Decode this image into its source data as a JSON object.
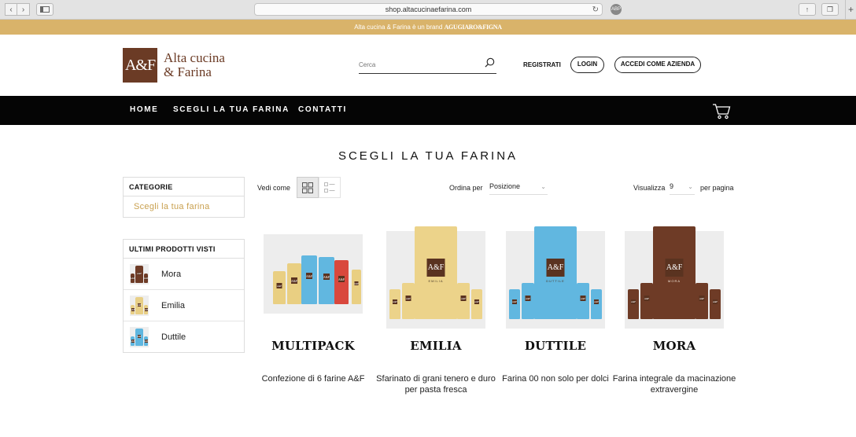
{
  "browser": {
    "url": "shop.altacucinaefarina.com",
    "ext_label": "ABP"
  },
  "brand_bar": {
    "text": "Alta cucina & Farina è un brand",
    "brand": "AGUGIARO&FIGNA"
  },
  "header": {
    "logo_mark": "A&F",
    "logo_line1": "Alta cucina",
    "logo_line2": "& Farina",
    "search_placeholder": "Cerca",
    "register": "REGISTRATI",
    "login": "LOGIN",
    "business_login": "ACCEDI COME AZIENDA"
  },
  "nav": {
    "items": [
      "HOME",
      "SCEGLI LA TUA FARINA",
      "CONTATTI"
    ]
  },
  "page": {
    "title": "SCEGLI LA TUA FARINA"
  },
  "sidebar": {
    "categories_title": "CATEGORIE",
    "category_link": "Scegli la tua farina",
    "recent_title": "ULTIMI PRODOTTI VISTI",
    "recent": [
      {
        "name": "Mora",
        "color": "#6e3b26"
      },
      {
        "name": "Emilia",
        "color": "#e8cf86"
      },
      {
        "name": "Duttile",
        "color": "#5fb6df"
      }
    ]
  },
  "toolbar": {
    "view_as": "Vedi come",
    "sort_label": "Ordina per",
    "sort_value": "Posizione",
    "show_label": "Visualizza",
    "show_value": "9",
    "per_page": "per pagina"
  },
  "products": [
    {
      "name": "MULTIPACK",
      "desc": "Confezione di 6 farine A&F",
      "color": "#e9cf82"
    },
    {
      "name": "EMILIA",
      "desc": "Sfarinato di grani tenero e duro per pasta fresca",
      "color": "#ecd38a"
    },
    {
      "name": "DUTTILE",
      "desc": "Farina 00 non solo per dolci",
      "color": "#61b7e0"
    },
    {
      "name": "MORA",
      "desc": "Farina integrale da macinazione extravergine",
      "color": "#6e3b26"
    }
  ],
  "product_labels": [
    "EMILIA",
    "DUTTILE",
    "MORA"
  ]
}
